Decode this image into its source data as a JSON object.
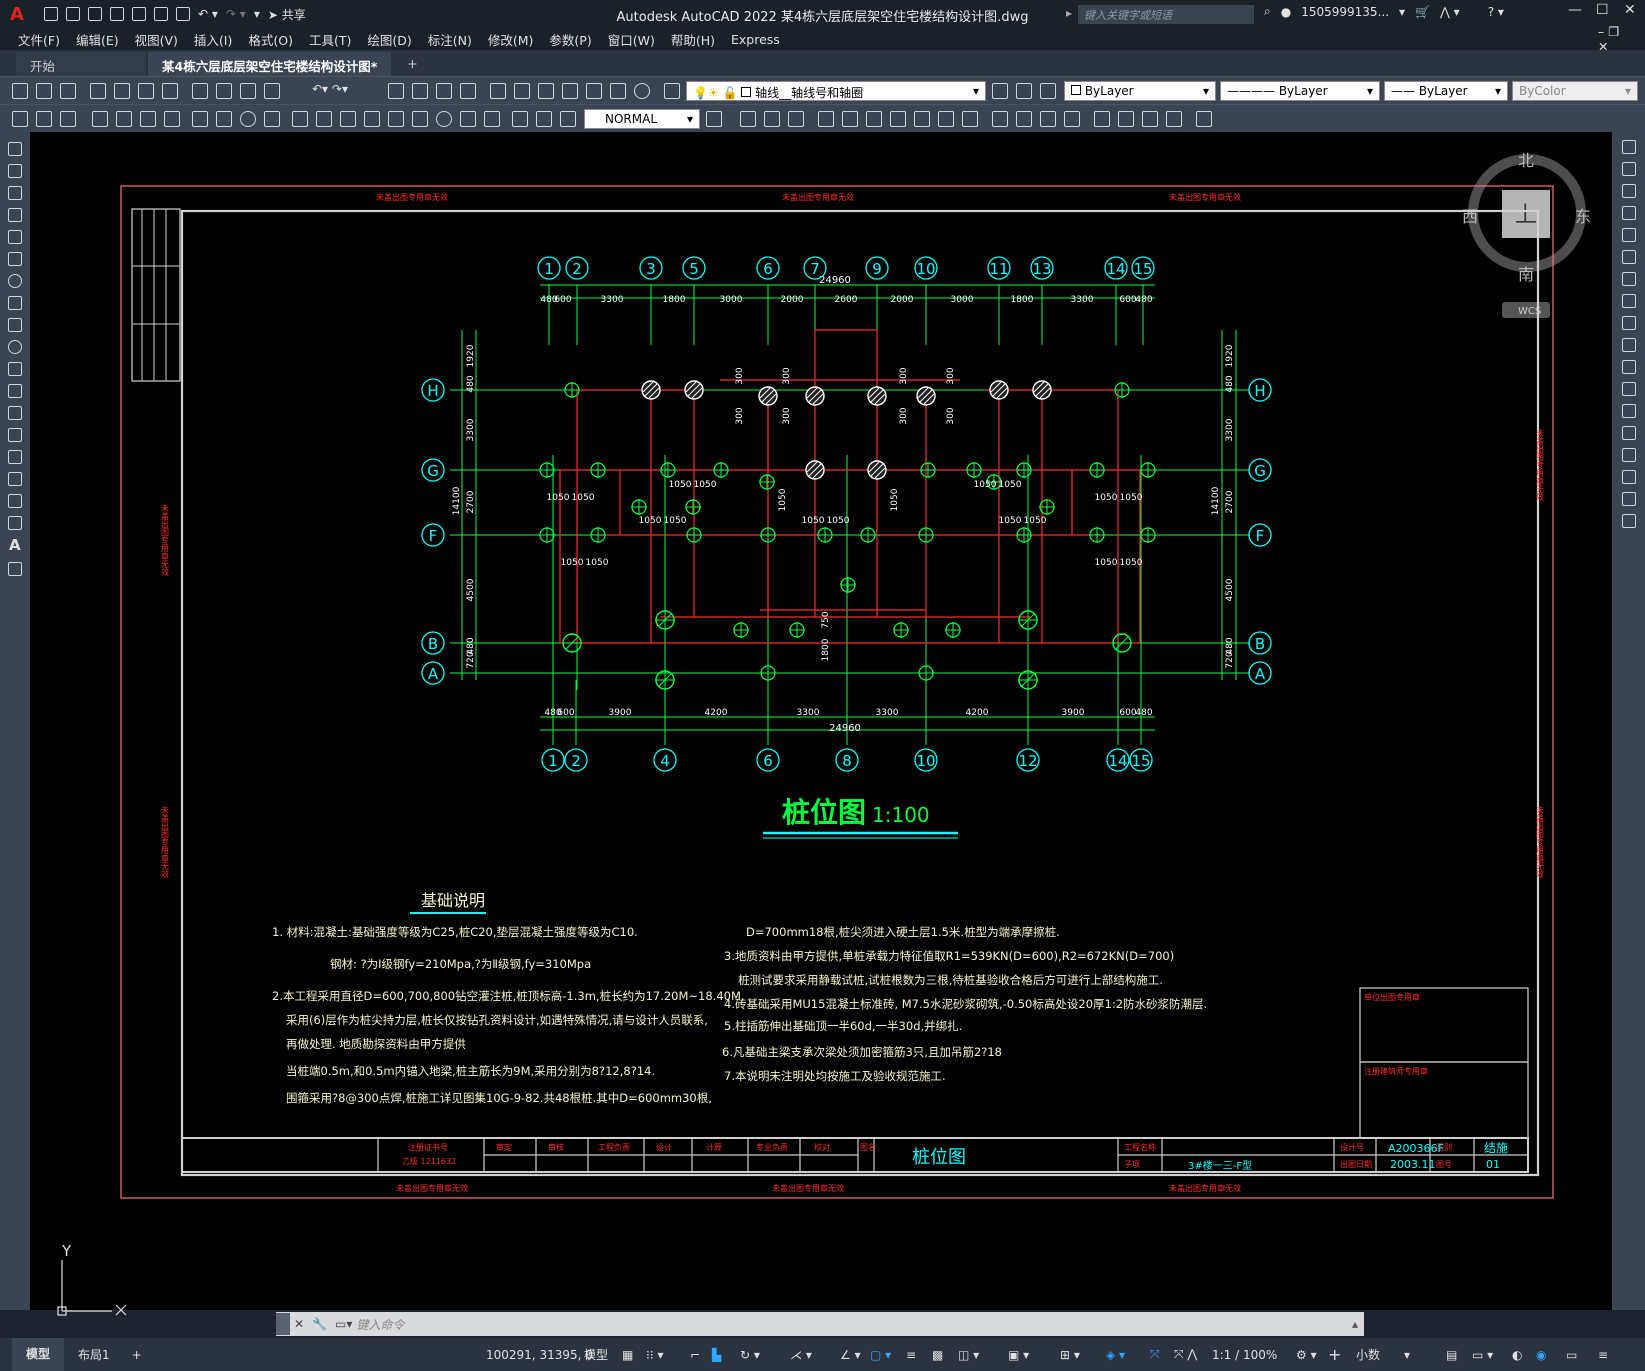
{
  "app": {
    "title": "Autodesk AutoCAD 2022    某4栋六层底层架空住宅楼结构设计图.dwg",
    "share": "共享",
    "search_placeholder": "键入关键字或短语",
    "user": "1505999135...",
    "logo": "A"
  },
  "menu": [
    "文件(F)",
    "编辑(E)",
    "视图(V)",
    "插入(I)",
    "格式(O)",
    "工具(T)",
    "绘图(D)",
    "标注(N)",
    "修改(M)",
    "参数(P)",
    "窗口(W)",
    "帮助(H)",
    "Express"
  ],
  "tabs": [
    {
      "label": "开始"
    },
    {
      "label": "某4栋六层底层架空住宅楼结构设计图*"
    },
    {
      "label": "+"
    }
  ],
  "toolbar": {
    "layer": "轴线__轴线号和轴圈",
    "color": "ByLayer",
    "linetype": "ByLayer",
    "lineweight": "ByLayer",
    "plotstyle": "ByColor",
    "dimstyle": "NORMAL"
  },
  "viewcube": {
    "n": "北",
    "s": "南",
    "e": "东",
    "w": "西",
    "top": "上",
    "wcs": "WCS"
  },
  "drawing": {
    "stamp": "未盖出图专用章无效",
    "title": "桩位图",
    "scale": "1:100",
    "total_dim": "24960",
    "top_axes": [
      "1",
      "2",
      "3",
      "5",
      "6",
      "7",
      "9",
      "10",
      "11",
      "13",
      "14",
      "15"
    ],
    "bottom_axes": [
      "1",
      "2",
      "4",
      "6",
      "8",
      "10",
      "12",
      "14",
      "15"
    ],
    "row_axes": [
      "H",
      "G",
      "F",
      "B",
      "A"
    ],
    "top_dims": [
      "480",
      "600",
      "3300",
      "1800",
      "3000",
      "2000",
      "2600",
      "2000",
      "3000",
      "1800",
      "3300",
      "600",
      "480"
    ],
    "bottom_dims": [
      "480",
      "600",
      "3900",
      "4200",
      "3300",
      "3300",
      "4200",
      "3900",
      "600",
      "480"
    ],
    "left_dims": [
      "1920",
      "480",
      "3300",
      "14100",
      "2700",
      "4500",
      "720",
      "480"
    ],
    "pile_dims": {
      "d1050": "1050",
      "d300": "300",
      "d750": "750",
      "d1800": "1800"
    },
    "notes_title": "基础说明",
    "notes_left": [
      "1. 材料:混凝土:基础强度等级为C25,桩C20,垫层混凝土强度等级为C10.",
      "钢材: ?为I级钢fy=210Mpa,?为Ⅱ级钢,fy=310Mpa",
      "2.本工程采用直径D=600,700,800钻空灌注桩,桩顶标高-1.3m,桩长约为17.20M~18.40M.",
      "采用(6)层作为桩尖持力层,桩长仅按钻孔资料设计,如遇特殊情况,请与设计人员联系,",
      "再做处理. 地质勘探资料由甲方提供",
      "当桩端0.5m,和0.5m内锚入地梁,桩主筋长为9M,采用分别为8?12,8?14.",
      "围箍采用?8@300点焊,桩施工详见图集10G-9-82.共48根桩.其中D=600mm30根,"
    ],
    "notes_right": [
      "D=700mm18根,桩尖须进入硬土层1.5米.桩型为端承摩擦桩.",
      "3.地质资料由甲方提供,单桩承载力特征值取R1=539KN(D=600),R2=672KN(D=700)",
      "桩测试要求采用静载试桩,试桩根数为三根,待桩基验收合格后方可进行上部结构施工.",
      "4.砖基础采用MU15混凝土标准砖, M7.5水泥砂浆砌筑,-0.50标高处设20厚1:2防水砂浆防潮层.",
      "5.柱插筋伸出基础顶一半60d,一半30d,并绑扎.",
      "6.凡基础主梁支承次梁处须加密箍筋3只,且加吊筋2?18",
      "7.本说明未注明处均按施工及验收规范施工."
    ],
    "titleblock": {
      "seal": "注册证书号",
      "cert": "乙级 1211632",
      "cols": [
        "审定",
        "审核",
        "工程负责",
        "设计",
        "计算",
        "专业负责",
        "校对"
      ],
      "dwg": "图名",
      "name": "桩位图",
      "proj_label": "工程名称",
      "proj_sub": "子项",
      "subitem": "3#楼一三-F型",
      "no_label": "设计号",
      "no": "A200366F",
      "date_label": "出图日期",
      "date": "2003.11",
      "cat_label": "图别",
      "cat": "结施",
      "num_label": "图号",
      "num": "01",
      "side1": "单位出图专用章",
      "side2": "注册建筑师专用章"
    }
  },
  "coords": {
    "x": "Y",
    "y": "X"
  },
  "cmd": {
    "placeholder": "键入命令"
  },
  "layouts": [
    "模型",
    "布局1",
    "+"
  ],
  "status": {
    "xy": "100291, 31395, 0",
    "space": "模型",
    "scale": "1:1 / 100%",
    "units": "小数"
  }
}
